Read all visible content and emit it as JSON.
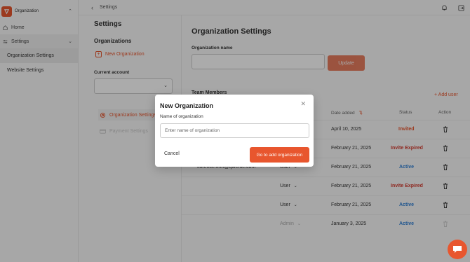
{
  "app": {
    "org_name": "Organization",
    "nav": {
      "home": "Home",
      "settings": "Settings"
    },
    "subnav": {
      "org_settings": "Organization Settings",
      "website_settings": "Website Settings"
    }
  },
  "topbar": {
    "breadcrumb": "Settings"
  },
  "settings_panel": {
    "title": "Settings",
    "organizations_heading": "Organizations",
    "new_org": "New Organization",
    "current_account": "Current account",
    "menu": {
      "org_settings": "Organization Settings",
      "payment_settings": "Payment Settings"
    }
  },
  "main": {
    "title": "Organization Settings",
    "org_name_label": "Organization name",
    "update_button": "Update",
    "section_title": "Team Members",
    "add_user": "+  Add user",
    "columns": {
      "date_added": "Date added",
      "status": "Status",
      "action": "Action"
    },
    "rows": [
      {
        "email": "",
        "role": "",
        "date": "April 10, 2025",
        "status": "Invited"
      },
      {
        "email": "",
        "role": "",
        "date": "February 21, 2025",
        "status": "Invite Expired"
      },
      {
        "email": "florence.firth@qwertle.com",
        "role": "User",
        "date": "February 21, 2025",
        "status": "Active"
      },
      {
        "email": "",
        "role": "User",
        "date": "February 21, 2025",
        "status": "Invite Expired"
      },
      {
        "email": "",
        "role": "User",
        "date": "February 21, 2025",
        "status": "Active"
      },
      {
        "email": "",
        "role": "Admin",
        "date": "January 3, 2025",
        "status": "Active"
      }
    ]
  },
  "modal": {
    "title": "New Organization",
    "label": "Name of organization",
    "placeholder": "Enter name of organization",
    "cancel": "Cancel",
    "submit": "Go to add organization"
  },
  "colors": {
    "accent": "#e8562e",
    "invited": "#e8562e",
    "expired": "#d43b2f",
    "active": "#2f7fd4"
  }
}
